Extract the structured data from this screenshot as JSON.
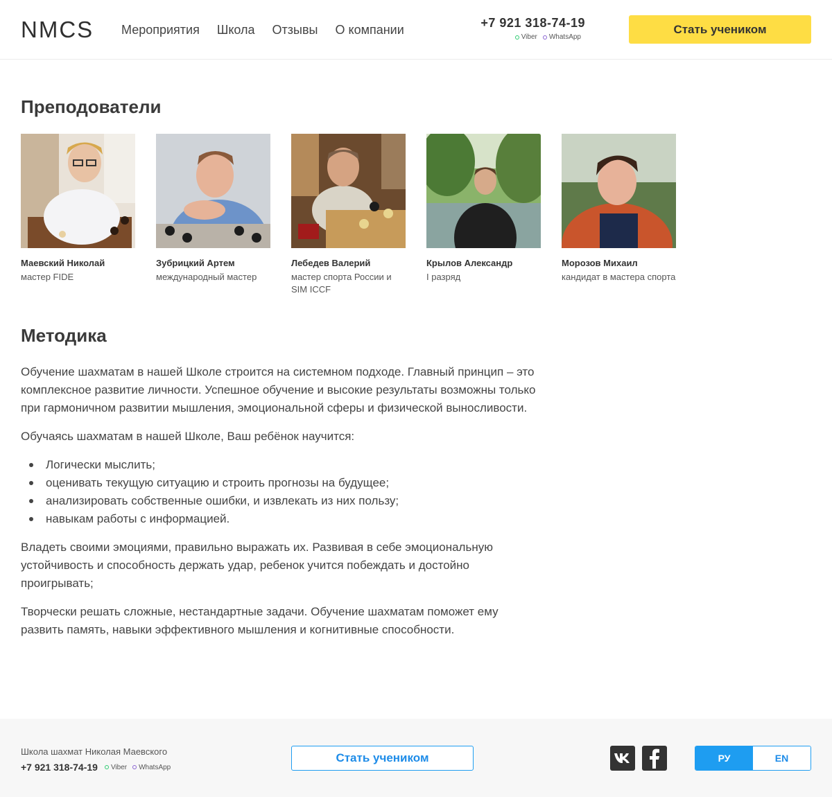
{
  "header": {
    "logo": "NMCS",
    "nav": [
      "Мероприятия",
      "Школа",
      "Отзывы",
      "О компании"
    ],
    "phone": "+7 921 318-74-19",
    "messengers": [
      "Viber",
      "WhatsApp"
    ],
    "cta": "Стать учеником"
  },
  "teachers": {
    "heading": "Преподователи",
    "items": [
      {
        "name": "Маевский Николай",
        "title": "мастер FIDE"
      },
      {
        "name": "Зубрицкий Артем",
        "title": "международный мастер"
      },
      {
        "name": "Лебедев Валерий",
        "title": "мастер спорта России и SIM ICCF"
      },
      {
        "name": "Крылов Александр",
        "title": "I разряд"
      },
      {
        "name": "Морозов Михаил",
        "title": "кандидат в мастера спорта"
      }
    ]
  },
  "method": {
    "heading": "Методика",
    "p1": "Обучение шахматам в нашей Школе строится на системном подходе. Главный принцип – это комплексное развитие личности. Успешное обучение и высокие результаты возможны только при гармоничном развитии мышления, эмоциональной сферы и физической выносливости.",
    "p2": "Обучаясь шахматам в нашей Школе, Ваш ребёнок научится:",
    "list": [
      "Логически мыслить;",
      "оценивать текущую ситуацию и строить прогнозы на будущее;",
      "анализировать собственные ошибки, и извлекать из них пользу;",
      "навыкам работы с информацией."
    ],
    "p3": "Владеть своими эмоциями, правильно выражать их. Развивая в себе эмоциональную устойчивость и способность держать удар, ребенок учится побеждать и достойно проигрывать;",
    "p4": "Творчески решать сложные, нестандартные задачи. Обучение шахматам поможет ему развить память,  навыки эффективного мышления и когнитивные способности."
  },
  "footer": {
    "school": "Школа шахмат Николая Маевского",
    "phone": "+7 921 318-74-19",
    "messengers": [
      "Viber",
      "WhatsApp"
    ],
    "cta": "Стать учеником",
    "lang": [
      "РУ",
      "EN"
    ]
  },
  "colors": {
    "accent_yellow": "#fedd44",
    "accent_blue": "#1e9df1"
  }
}
